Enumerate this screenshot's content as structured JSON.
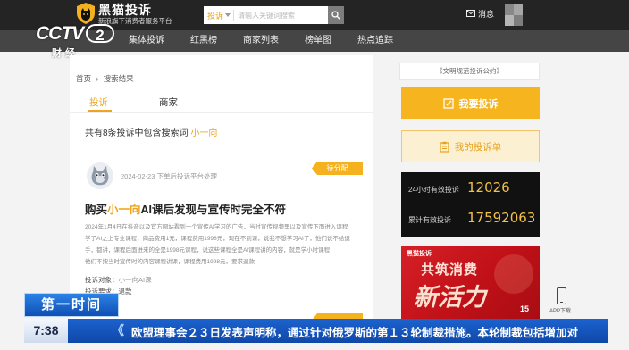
{
  "header": {
    "logo_title": "黑猫投诉",
    "logo_subtitle": "新浪旗下消费者服务平台",
    "search_scope": "投诉",
    "search_placeholder": "请输入关键词搜索",
    "message_label": "消息"
  },
  "nav": [
    "集体投诉",
    "红黑榜",
    "商家列表",
    "榜单图",
    "热点追踪"
  ],
  "breadcrumb": {
    "home": "首页",
    "separator": "›",
    "current": "搜索结果"
  },
  "tabs": [
    {
      "label": "投诉",
      "active": true
    },
    {
      "label": "商家",
      "active": false
    }
  ],
  "summary": {
    "text": "共有8条投诉中包含搜索词 ",
    "keyword": "小一向"
  },
  "complaint": {
    "date_line": "2024-02-23 下单后投诉平台处理",
    "status": "待分配",
    "title_prefix": "购买",
    "title_keyword": "小一向",
    "title_suffix": "AI课后发现与宣传时完全不符",
    "body": [
      "2024年1月4日在抖音以及官方网站看到一个宣传AI学习的广告，当时宣传视频里以及宣传下面进入课程",
      "学了AI之上专业课程，商品费用1元，课程费用1998元，现在不到课，说我不想学习AI了，他们说不给退",
      "手，都讲，课程后面进来的全是1998元课程，说这些课程全是AI课程讲的内容，就是学小时课程",
      "他们不按当时宣传时的内容课程讲课，课程费用1998元，要求退款"
    ],
    "target_label": "投诉对象：",
    "target_value": "小一向AI课",
    "demand_label": "投诉要求：",
    "demand_value": "退款"
  },
  "sidebar": {
    "pledge": "《文明规范投诉公约》",
    "complain_button": "我要投诉",
    "my_complaints_button": "我的投诉单",
    "stats": [
      {
        "label": "24小时有效投诉",
        "value": "12026"
      },
      {
        "label": "累计有效投诉",
        "value": "17592063"
      }
    ],
    "banner": {
      "brand": "黑猫投诉",
      "line1": "共筑消费",
      "line2": "新活力",
      "badge": "15"
    },
    "app_download": "APP下载"
  },
  "broadcast": {
    "channel_logo": "CCTV",
    "channel_number": "2",
    "channel_name": "财经",
    "program": "第一时间",
    "time": "7:38",
    "ticker_mark": "《",
    "ticker": "欧盟理事会２３日发表声明称，通过针对俄罗斯的第１３轮制裁措施。本轮制裁包括增加对"
  },
  "colors": {
    "accent": "#f5b21e",
    "header": "#242424",
    "nav": "#454545",
    "stats_bg": "#111111",
    "stats_value": "#f2c14a",
    "program_blue": "#1558c4",
    "banner_red": "#c8161d"
  },
  "icons": {
    "logo": "black-cat-shield-icon",
    "search": "magnifier-icon",
    "messages": "envelope-icon",
    "complain": "edit-pen-icon",
    "my_complaints": "clipboard-icon",
    "app": "phone-icon",
    "user_avatar": "cat-avatar-icon"
  }
}
